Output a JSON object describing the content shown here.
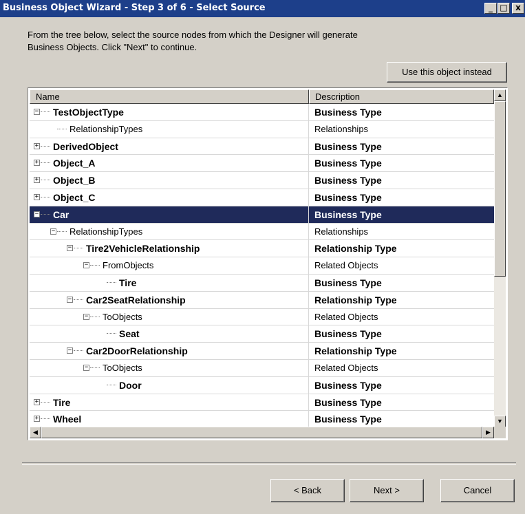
{
  "window": {
    "title": "Business Object Wizard - Step 3 of 6 - Select Source",
    "controls": {
      "minimize": "_",
      "maximize": "□",
      "close": "x"
    }
  },
  "instructions": "From the tree below, select the source nodes from which the Designer will generate Business Objects. Click \"Next\" to continue.",
  "use_object_button": "Use this object instead",
  "tree": {
    "columns": {
      "name": "Name",
      "description": "Description"
    },
    "rows": [
      {
        "name": "TestObjectType",
        "description": "Business Type",
        "level": 0,
        "toggle": "-",
        "bold": true
      },
      {
        "name": "RelationshipTypes",
        "description": "Relationships",
        "level": 1,
        "toggle": "",
        "bold": false
      },
      {
        "name": "DerivedObject",
        "description": "Business Type",
        "level": 0,
        "toggle": "+",
        "bold": true
      },
      {
        "name": "Object_A",
        "description": "Business Type",
        "level": 0,
        "toggle": "+",
        "bold": true
      },
      {
        "name": "Object_B",
        "description": "Business Type",
        "level": 0,
        "toggle": "+",
        "bold": true
      },
      {
        "name": "Object_C",
        "description": "Business Type",
        "level": 0,
        "toggle": "+",
        "bold": true
      },
      {
        "name": "Car",
        "description": "Business Type",
        "level": 0,
        "toggle": "-",
        "bold": true,
        "selected": true
      },
      {
        "name": "RelationshipTypes",
        "description": "Relationships",
        "level": 1,
        "toggle": "-",
        "bold": false
      },
      {
        "name": "Tire2VehicleRelationship",
        "description": "Relationship Type",
        "level": 2,
        "toggle": "-",
        "bold": true
      },
      {
        "name": "FromObjects",
        "description": "Related Objects",
        "level": 3,
        "toggle": "-",
        "bold": false
      },
      {
        "name": "Tire",
        "description": "Business Type",
        "level": 4,
        "toggle": "",
        "bold": true
      },
      {
        "name": "Car2SeatRelationship",
        "description": "Relationship Type",
        "level": 2,
        "toggle": "-",
        "bold": true
      },
      {
        "name": "ToObjects",
        "description": "Related Objects",
        "level": 3,
        "toggle": "-",
        "bold": false
      },
      {
        "name": "Seat",
        "description": "Business Type",
        "level": 4,
        "toggle": "",
        "bold": true
      },
      {
        "name": "Car2DoorRelationship",
        "description": "Relationship Type",
        "level": 2,
        "toggle": "-",
        "bold": true
      },
      {
        "name": "ToObjects",
        "description": "Related Objects",
        "level": 3,
        "toggle": "-",
        "bold": false
      },
      {
        "name": "Door",
        "description": "Business Type",
        "level": 4,
        "toggle": "",
        "bold": true
      },
      {
        "name": "Tire",
        "description": "Business Type",
        "level": 0,
        "toggle": "+",
        "bold": true
      },
      {
        "name": "Wheel",
        "description": "Business Type",
        "level": 0,
        "toggle": "+",
        "bold": true
      }
    ]
  },
  "buttons": {
    "back": "< Back",
    "next": "Next >",
    "cancel": "Cancel"
  }
}
